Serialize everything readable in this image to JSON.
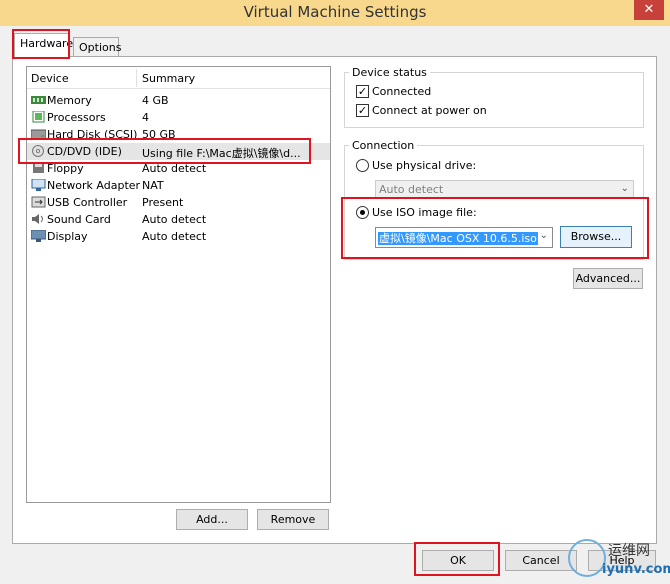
{
  "window": {
    "title": "Virtual Machine Settings",
    "close_glyph": "✕"
  },
  "tabs": [
    {
      "label": "Hardware"
    },
    {
      "label": "Options"
    }
  ],
  "device_list": {
    "col_device": "Device",
    "col_summary": "Summary",
    "rows": [
      {
        "name": "Memory",
        "summary": "4 GB",
        "icon": "memory-icon"
      },
      {
        "name": "Processors",
        "summary": "4",
        "icon": "processor-icon"
      },
      {
        "name": "Hard Disk (SCSI)",
        "summary": "50 GB",
        "icon": "hard-disk-icon"
      },
      {
        "name": "CD/DVD (IDE)",
        "summary": "Using file F:\\Mac虚拟\\镜像\\d...",
        "icon": "cd-dvd-icon"
      },
      {
        "name": "Floppy",
        "summary": "Auto detect",
        "icon": "floppy-icon"
      },
      {
        "name": "Network Adapter",
        "summary": "NAT",
        "icon": "network-icon"
      },
      {
        "name": "USB Controller",
        "summary": "Present",
        "icon": "usb-icon"
      },
      {
        "name": "Sound Card",
        "summary": "Auto detect",
        "icon": "sound-icon"
      },
      {
        "name": "Display",
        "summary": "Auto detect",
        "icon": "display-icon"
      }
    ],
    "add_label": "Add...",
    "remove_label": "Remove"
  },
  "device_status": {
    "label": "Device status",
    "connected": "Connected",
    "connect_at_power_on": "Connect at power on"
  },
  "connection": {
    "label": "Connection",
    "physical_drive": "Use physical drive:",
    "physical_drive_value": "Auto detect",
    "iso_image": "Use ISO image file:",
    "iso_value": "虚拟\\镜像\\Mac OSX 10.6.5.iso",
    "browse_label": "Browse...",
    "advanced_label": "Advanced..."
  },
  "footer": {
    "ok_label": "OK",
    "cancel_label": "Cancel",
    "help_label": "Help"
  },
  "watermark": {
    "cn_text": "运维网",
    "url": "iyunv.com"
  },
  "colors": {
    "title_bar": "#f7d88d",
    "highlight_box": "#e0141e",
    "selection": "#3399ff"
  }
}
